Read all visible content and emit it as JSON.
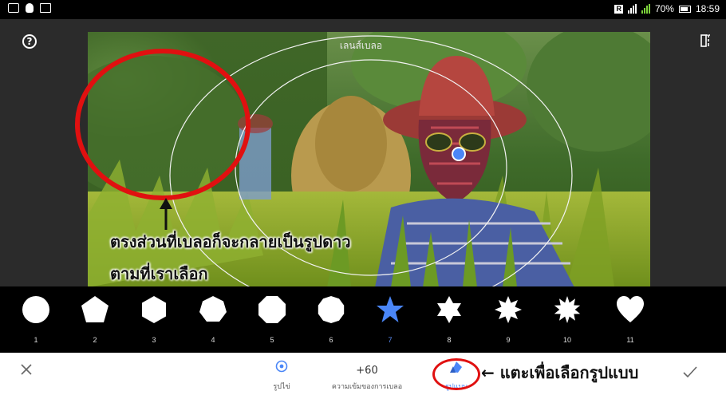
{
  "status_bar": {
    "battery_percent": "70%",
    "time": "18:59",
    "left_icons": [
      "gallery-icon",
      "notification-icon",
      "mail-icon"
    ],
    "right_icons": [
      "r-badge-icon",
      "signal-icon",
      "signal-green-icon",
      "battery-icon"
    ],
    "r_badge": "R"
  },
  "editor": {
    "help_icon": "help-icon",
    "compare_icon": "compare-icon",
    "filter_name": "เลนส์เบลอ",
    "annotation_line1": "ตรงส่วนที่เบลอก็จะกลายเป็นรูปดาว",
    "annotation_line2": "ตามที่เราเลือก"
  },
  "shapes": {
    "items": [
      {
        "num": "1",
        "shape": "circle"
      },
      {
        "num": "2",
        "shape": "pentagon"
      },
      {
        "num": "3",
        "shape": "hexagon"
      },
      {
        "num": "4",
        "shape": "heptagon"
      },
      {
        "num": "5",
        "shape": "octagon"
      },
      {
        "num": "6",
        "shape": "decagon"
      },
      {
        "num": "7",
        "shape": "star-5"
      },
      {
        "num": "8",
        "shape": "star-6"
      },
      {
        "num": "9",
        "shape": "star-8"
      },
      {
        "num": "10",
        "shape": "star-10"
      },
      {
        "num": "11",
        "shape": "heart"
      }
    ],
    "active": "7",
    "active_color": "#4a86f7"
  },
  "bottom_bar": {
    "close_icon": "close-icon",
    "shape_tool_label": "รูปไข่",
    "strength_value": "+60",
    "strength_label": "ความเข้มของการเบลอ",
    "style_label": "รูปแบบ",
    "style_annotation": "← แตะเพื่อเลือกรูปแบบ",
    "apply_icon": "check-icon",
    "accent_color": "#4a86f7",
    "annotation_color": "#e01010"
  }
}
